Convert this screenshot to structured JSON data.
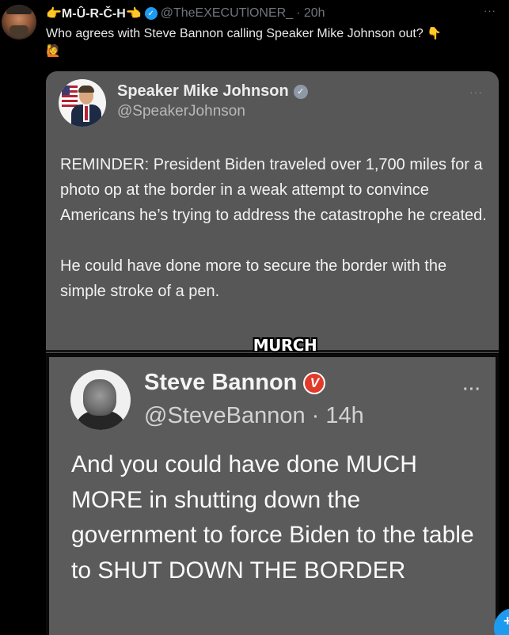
{
  "post": {
    "display_name": "👉M-Û-R-Č-H👈",
    "handle": "@TheEXECUTlONER_",
    "time": "· 20h",
    "text": "Who agrees with Steve Bannon calling Speaker Mike Johnson out?",
    "emoji_1": "👇",
    "emoji_2": "🙋",
    "more": "···"
  },
  "quoted_tweet_1": {
    "name": "Speaker Mike Johnson",
    "handle": "@SpeakerJohnson",
    "more": "···",
    "paragraph_1": "REMINDER: President Biden traveled over 1,700 miles for a photo op at the border in a weak attempt to convince Americans he’s trying to address the catastrophe he created.",
    "paragraph_2": "He could have done more to secure the border with the simple stroke of a pen."
  },
  "caption": "MURCH",
  "quoted_tweet_2": {
    "name": "Steve Bannon",
    "badge": "V",
    "handle_time": "@SteveBannon · 14h",
    "more": "···",
    "body": "And you could have done MUCH MORE in shutting down the government to force Biden to the table to SHUT DOWN THE BORDER"
  },
  "fab": {
    "icon": "plus-icon",
    "glyph": "+"
  },
  "colors": {
    "background": "#000000",
    "accent": "#1d9bf0",
    "card_1": "#575757",
    "card_2": "#5b5b5b",
    "badge_red": "#e23a2a"
  }
}
